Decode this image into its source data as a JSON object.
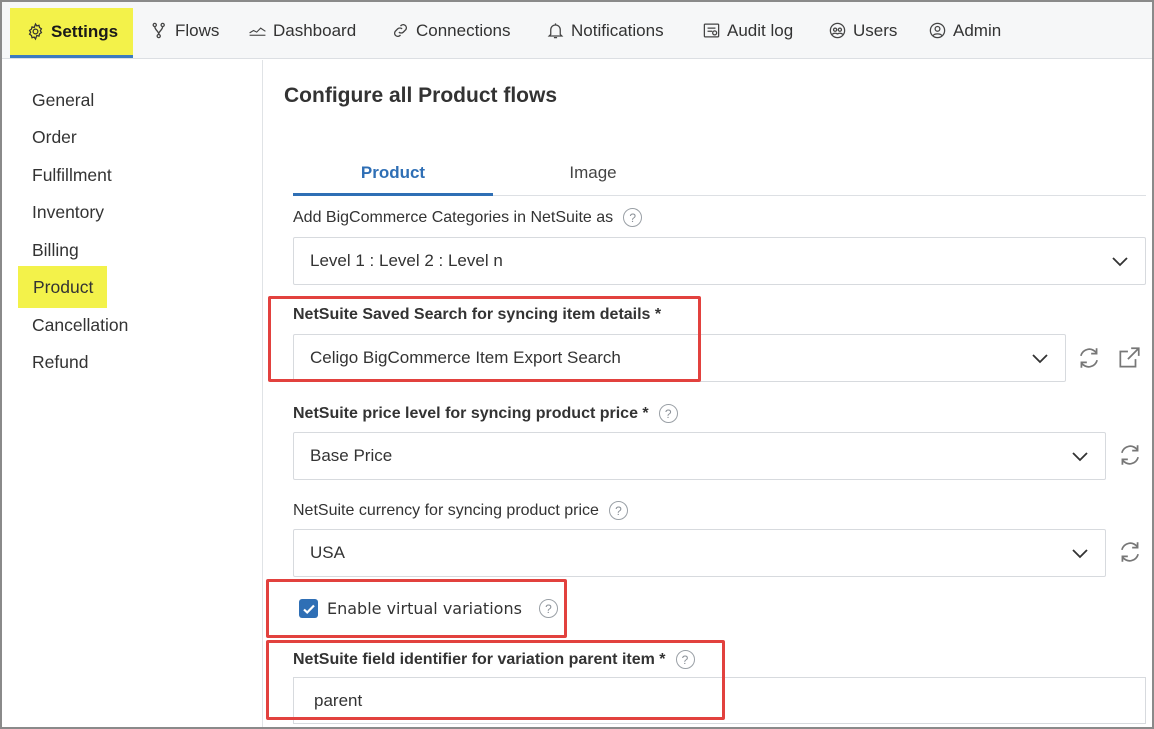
{
  "nav": {
    "settings": "Settings",
    "flows": "Flows",
    "dashboard": "Dashboard",
    "connections": "Connections",
    "notifications": "Notifications",
    "audit_log": "Audit log",
    "users": "Users",
    "admin": "Admin"
  },
  "sidebar": {
    "items": [
      {
        "label": "General"
      },
      {
        "label": "Order"
      },
      {
        "label": "Fulfillment"
      },
      {
        "label": "Inventory"
      },
      {
        "label": "Billing"
      },
      {
        "label": "Product"
      },
      {
        "label": "Cancellation"
      },
      {
        "label": "Refund"
      }
    ],
    "active": "Product"
  },
  "main": {
    "title": "Configure all Product flows",
    "tabs": [
      {
        "label": "Product"
      },
      {
        "label": "Image"
      }
    ],
    "fields": {
      "categories": {
        "label": "Add BigCommerce Categories in NetSuite as",
        "value": "Level 1 : Level 2 : Level n"
      },
      "saved_search": {
        "label": "NetSuite Saved Search for syncing item details *",
        "value": "Celigo BigCommerce Item Export Search"
      },
      "price_level": {
        "label": "NetSuite price level for syncing product price *",
        "value": "Base Price"
      },
      "currency": {
        "label": "NetSuite currency for syncing product price",
        "value": "USA"
      },
      "virtual_variations": {
        "label": "Enable virtual variations",
        "checked": true
      },
      "parent_identifier": {
        "label": "NetSuite field identifier for variation parent item *",
        "value": "parent"
      }
    },
    "help_glyph": "?"
  },
  "colors": {
    "highlight": "#f3f24a",
    "accent": "#2f6fb5",
    "annotation": "#e2413e"
  },
  "icons": [
    "gear-icon",
    "flows-icon",
    "dashboard-icon",
    "link-icon",
    "bell-icon",
    "audit-log-icon",
    "users-icon",
    "admin-icon",
    "chevron-down-icon",
    "refresh-icon",
    "external-link-icon",
    "checkmark-icon",
    "help-icon"
  ]
}
